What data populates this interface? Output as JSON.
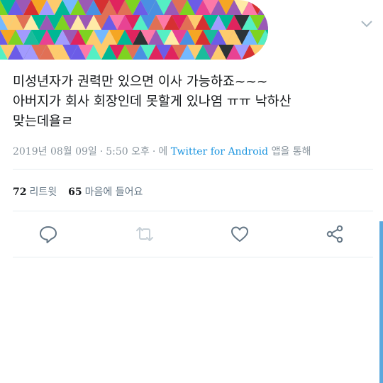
{
  "tweet": {
    "text": "미성년자가 권력만 있으면 이사 가능하죠~~~\n아버지가 회사 회장인데 못할게 있나염 ㅠㅠ 낙하산\n맞는데욜ㄹ",
    "date": "2019년 08월 09일",
    "separator": "·",
    "time": "5:50 오후",
    "via_prefix": "에",
    "via_app": "Twitter for Android",
    "via_suffix": "앱을 통해"
  },
  "stats": {
    "retweets_count": "72",
    "retweets_label": "리트윗",
    "likes_count": "65",
    "likes_label": "마음에 들어요"
  },
  "icons": {
    "menu": "chevron-down-icon",
    "reply": "reply-icon",
    "retweet": "retweet-icon",
    "like": "heart-icon",
    "share": "share-icon"
  },
  "colors": {
    "link": "#1b95e0",
    "muted": "#8a959e",
    "divider": "#e6ecf0",
    "icon": "#657786",
    "scrollbar": "#5ba8de"
  }
}
